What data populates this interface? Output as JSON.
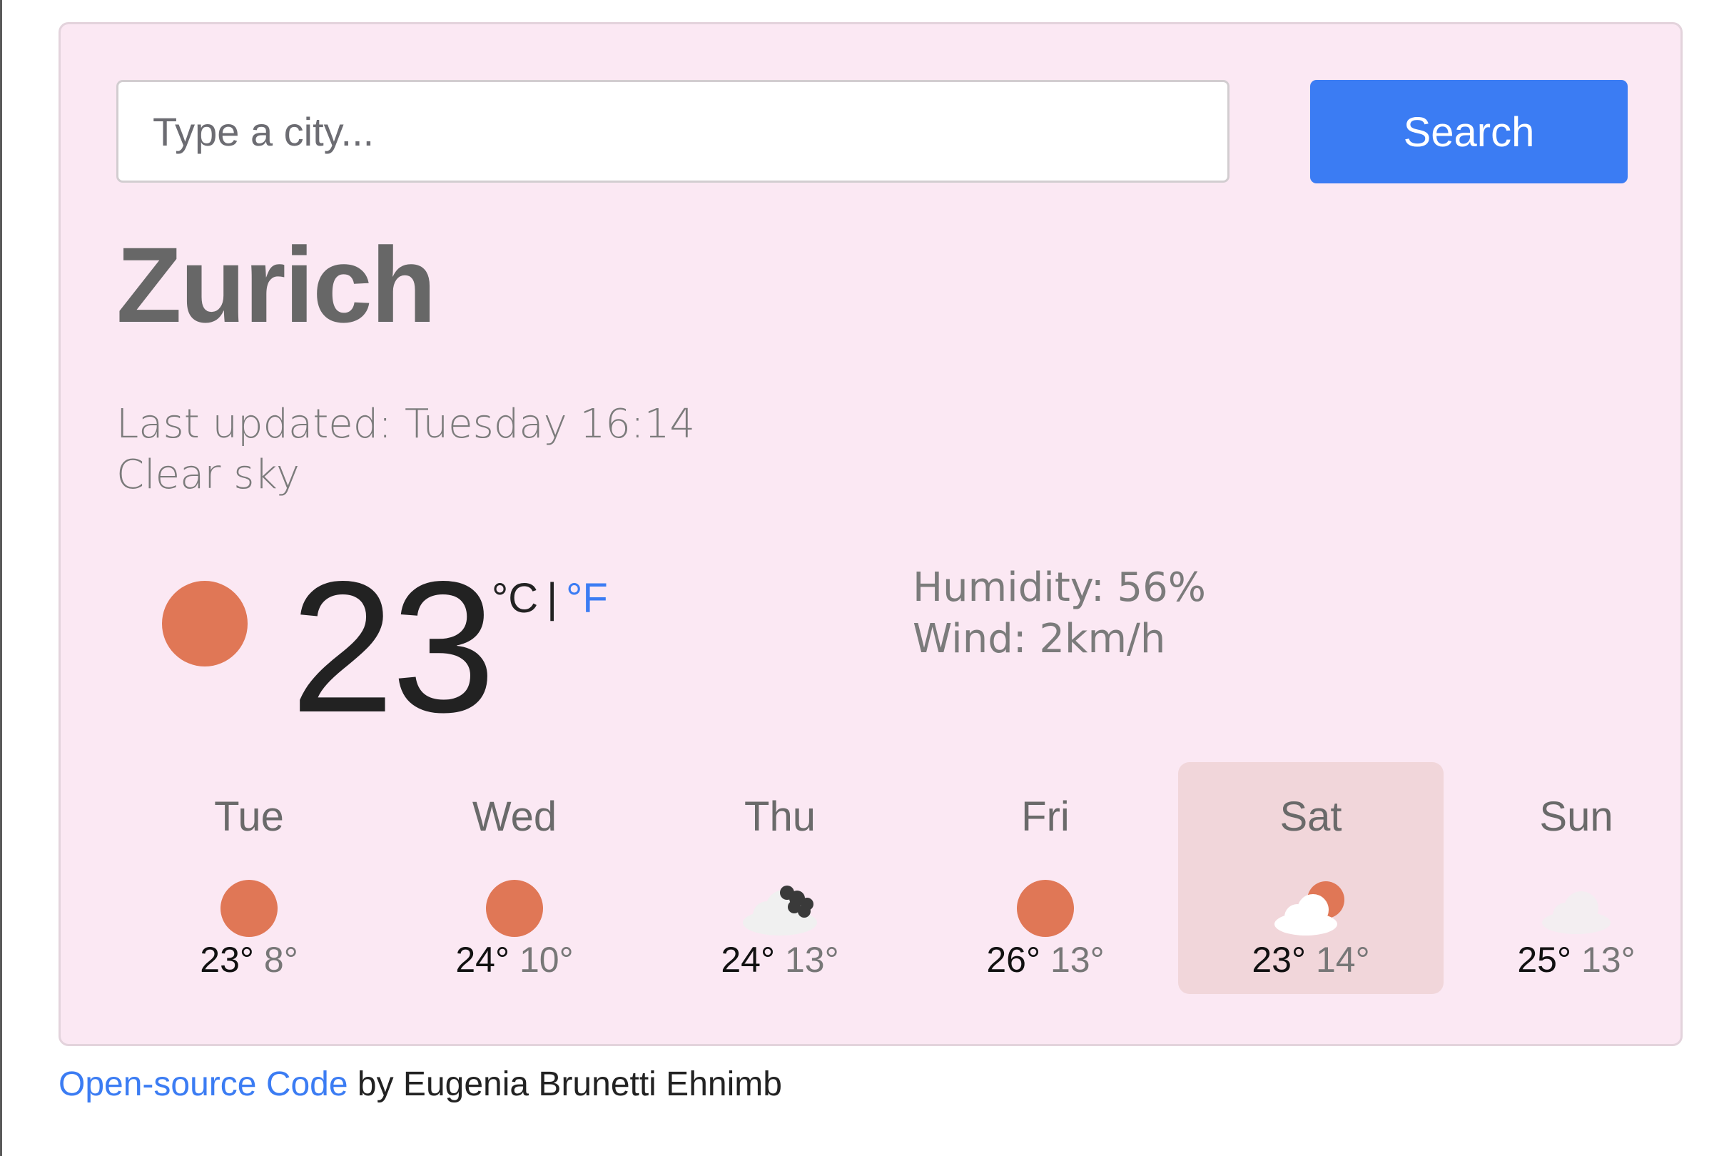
{
  "search": {
    "placeholder": "Type a city...",
    "button_label": "Search"
  },
  "current": {
    "city": "Zurich",
    "last_updated": "Last updated: Tuesday 16:14",
    "description": "Clear sky",
    "temperature": "23",
    "icon": "sun-icon",
    "unit_celsius": "°C",
    "unit_separator": "|",
    "unit_fahrenheit": "°F",
    "humidity": "Humidity: 56%",
    "wind": "Wind: 2km/h"
  },
  "forecast": [
    {
      "day": "Tue",
      "icon": "sun-icon",
      "max": "23°",
      "min": "8°"
    },
    {
      "day": "Wed",
      "icon": "sun-icon",
      "max": "24°",
      "min": "10°"
    },
    {
      "day": "Thu",
      "icon": "dark-clouds-icon",
      "max": "24°",
      "min": "13°"
    },
    {
      "day": "Fri",
      "icon": "sun-icon",
      "max": "26°",
      "min": "13°"
    },
    {
      "day": "Sat",
      "icon": "sun-behind-cloud-icon",
      "max": "23°",
      "min": "14°",
      "selected": true
    },
    {
      "day": "Sun",
      "icon": "cloud-icon",
      "max": "25°",
      "min": "13°"
    }
  ],
  "footer": {
    "link_text": "Open-source Code",
    "author_text": " by Eugenia Brunetti Ehnimb"
  },
  "colors": {
    "accent": "#3b7cf3",
    "card_background": "#fbe8f3",
    "sun": "#e07756",
    "selected_day": "#f1d6da"
  }
}
